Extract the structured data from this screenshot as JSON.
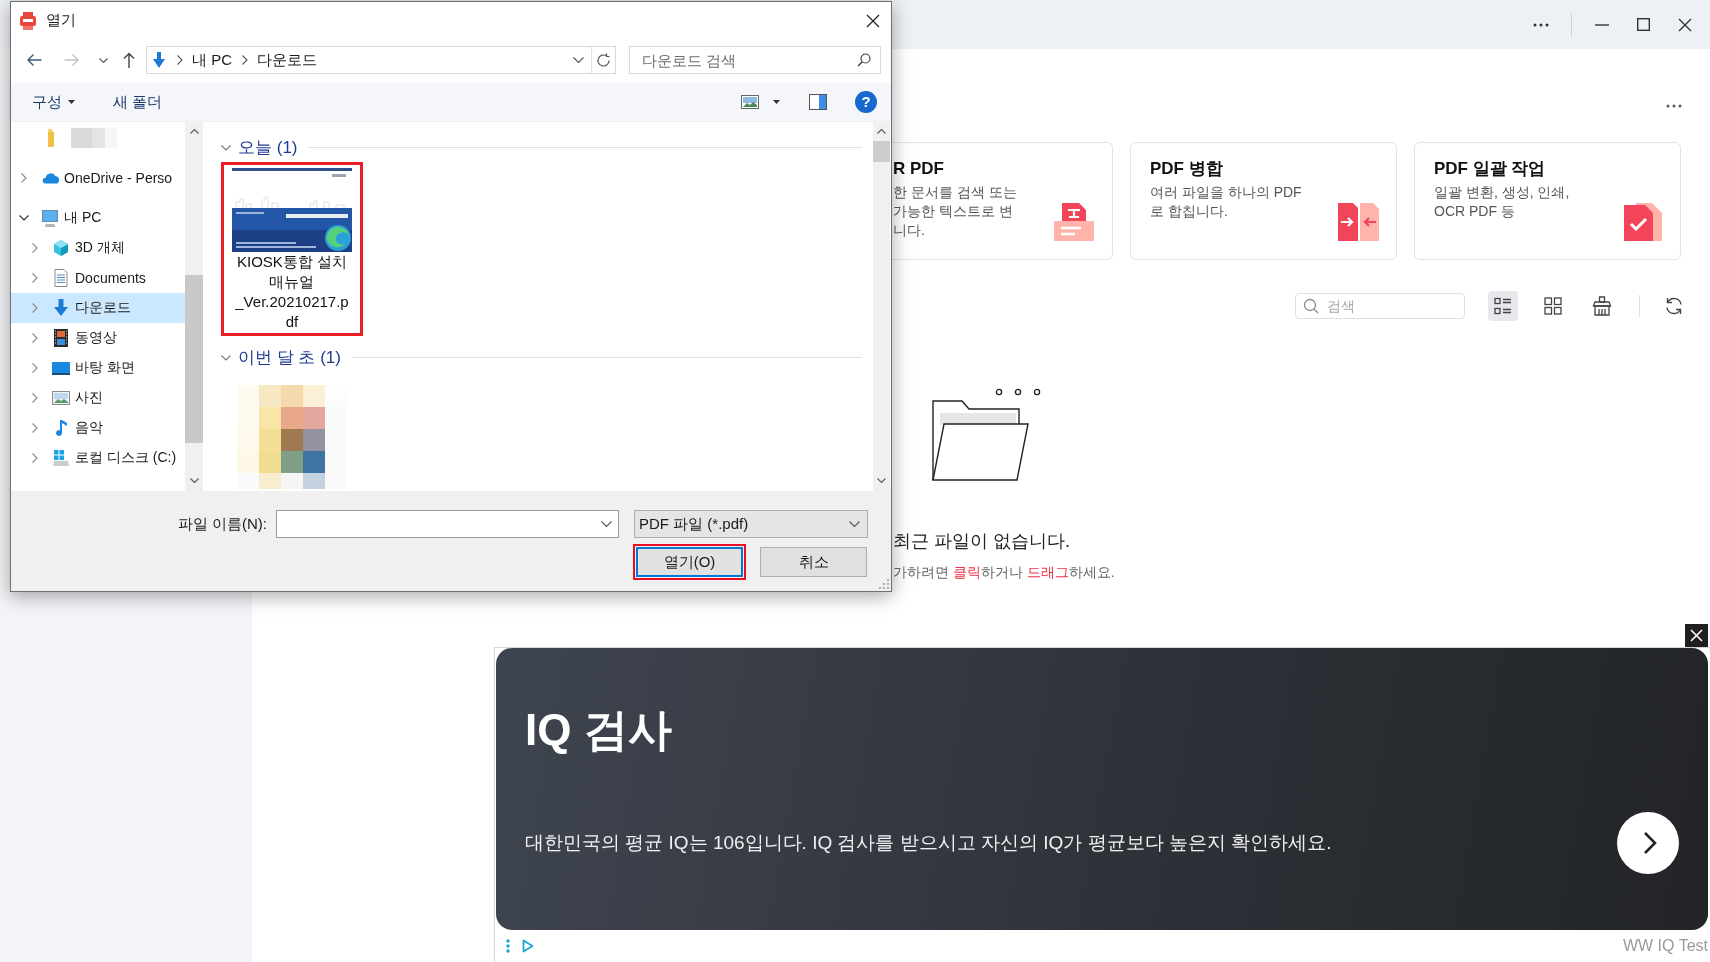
{
  "app": {
    "cards": [
      {
        "kind": "ocr",
        "title": "R PDF",
        "lines": [
          "한 문서를 검색 또는",
          "가능한 텍스트로 변",
          "니다."
        ]
      },
      {
        "kind": "merge",
        "title": "PDF 병합",
        "lines": [
          "여러 파일을 하나의 PDF",
          "로 합칩니다."
        ]
      },
      {
        "kind": "batch",
        "title": "PDF 일괄 작업",
        "lines": [
          "일괄 변환, 생성, 인쇄,",
          "OCR PDF 등"
        ]
      }
    ],
    "search": {
      "placeholder": "검색"
    },
    "view_buttons": [
      {
        "kind": "list",
        "selected": true
      },
      {
        "kind": "grid",
        "selected": false
      }
    ],
    "empty_state": {
      "message": "최근 파일이 없습니다.",
      "hint": [
        {
          "text": "가하려면 ",
          "link": false
        },
        {
          "text": "클릭",
          "link": true
        },
        {
          "text": "하거나 ",
          "link": false
        },
        {
          "text": "드래그",
          "link": true
        },
        {
          "text": "하세요.",
          "link": false
        }
      ]
    }
  },
  "dialog": {
    "title": "열기",
    "nav_buttons": [
      {
        "kind": "back",
        "disabled": false
      },
      {
        "kind": "forward",
        "disabled": true
      },
      {
        "kind": "recent",
        "disabled": false
      },
      {
        "kind": "up",
        "disabled": false
      }
    ],
    "breadcrumb": [
      "내 PC",
      "다운로드"
    ],
    "search": {
      "placeholder": "다운로드 검색"
    },
    "commands": [
      {
        "label": "구성",
        "has_menu": true
      },
      {
        "label": "새 폴더",
        "has_menu": false
      }
    ],
    "help": "?",
    "nav_tree": [
      {
        "kind": "folder",
        "redacted": true,
        "selected": false
      },
      {
        "kind": "cloud",
        "label": "OneDrive - Perso",
        "expanded": false,
        "selected": false
      },
      {
        "kind": "pc",
        "label": "내 PC",
        "expanded": true,
        "selected": false,
        "children": [
          {
            "kind": "objects3d",
            "label": "3D 개체",
            "expanded": false,
            "selected": false
          },
          {
            "kind": "documents",
            "label": "Documents",
            "expanded": false,
            "selected": false
          },
          {
            "kind": "downloads",
            "label": "다운로드",
            "expanded": false,
            "selected": true
          },
          {
            "kind": "videos",
            "label": "동영상",
            "expanded": false,
            "selected": false
          },
          {
            "kind": "desktop",
            "label": "바탕 화면",
            "expanded": false,
            "selected": false
          },
          {
            "kind": "pictures",
            "label": "사진",
            "expanded": false,
            "selected": false
          },
          {
            "kind": "music",
            "label": "음악",
            "expanded": false,
            "selected": false
          },
          {
            "kind": "drive",
            "label": "로컬 디스크 (C:)",
            "expanded": false,
            "selected": false
          }
        ]
      }
    ],
    "groups": [
      {
        "label": "오늘 (1)",
        "expanded": true,
        "files": [
          {
            "kind": "pdf",
            "name_lines": [
              "KIOSK통합 설치",
              "매뉴얼",
              "_Ver.20210217.p",
              "df"
            ],
            "highlighted": true
          }
        ]
      },
      {
        "label": "이번 달 초 (1)",
        "expanded": true,
        "files": [
          {
            "kind": "image",
            "highlighted": false
          }
        ]
      }
    ],
    "file_name": {
      "label": "파일 이름(N):"
    },
    "file_type": {
      "value": "PDF 파일 (*.pdf)"
    },
    "buttons": [
      {
        "label": "열기(O)",
        "default": true,
        "highlighted": true
      },
      {
        "label": "취소",
        "default": false,
        "highlighted": false
      }
    ]
  },
  "ad": {
    "title": "IQ 검사",
    "text": "대한민국의 평균 IQ는 106입니다. IQ 검사를 받으시고 자신의 IQ가 평균보다 높은지 확인하세요.",
    "advertiser": "WW IQ Test"
  }
}
